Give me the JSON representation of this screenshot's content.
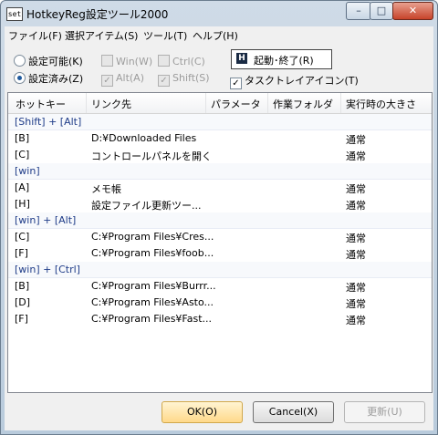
{
  "window": {
    "title": "HotkeyReg設定ツール2000",
    "app_icon_text": "set",
    "controls": {
      "minimize": "–",
      "maximize": "□",
      "close": "✕"
    }
  },
  "menu": [
    "ファイル(F)",
    "選択アイテム(S)",
    "ツール(T)",
    "ヘルプ(H)"
  ],
  "options": {
    "radio_settable": "設定可能(K)",
    "radio_configured": "設定済み(Z)",
    "win": "Win(W)",
    "ctrl": "Ctrl(C)",
    "alt": "Alt(A)",
    "shift": "Shift(S)",
    "start_stop": "起動･終了(R)",
    "tray_icon": "タスクトレイアイコン(T)"
  },
  "columns": [
    "ホットキー",
    "リンク先",
    "パラメータ",
    "作業フォルダ",
    "実行時の大きさ"
  ],
  "groups": [
    {
      "label": "[Shift] + [Alt]",
      "rows": [
        {
          "key": "[B]",
          "link": "D:¥Downloaded Files",
          "size": "通常"
        },
        {
          "key": "[C]",
          "link": "コントロールパネルを開く",
          "size": "通常"
        }
      ]
    },
    {
      "label": "[win]",
      "rows": [
        {
          "key": "[A]",
          "link": "メモ帳",
          "size": "通常"
        },
        {
          "key": "[H]",
          "link": "設定ファイル更新ツー...",
          "size": "通常"
        }
      ]
    },
    {
      "label": "[win] + [Alt]",
      "rows": [
        {
          "key": "[C]",
          "link": "C:¥Program Files¥Cres...",
          "size": "通常"
        },
        {
          "key": "[F]",
          "link": "C:¥Program Files¥foob...",
          "size": "通常"
        }
      ]
    },
    {
      "label": "[win] + [Ctrl]",
      "rows": [
        {
          "key": "[B]",
          "link": "C:¥Program Files¥Burrr...",
          "size": "通常"
        },
        {
          "key": "[D]",
          "link": "C:¥Program Files¥Asto...",
          "size": "通常"
        },
        {
          "key": "[F]",
          "link": "C:¥Program Files¥Fast...",
          "size": "通常"
        }
      ]
    }
  ],
  "buttons": {
    "ok": "OK(O)",
    "cancel": "Cancel(X)",
    "update": "更新(U)"
  }
}
